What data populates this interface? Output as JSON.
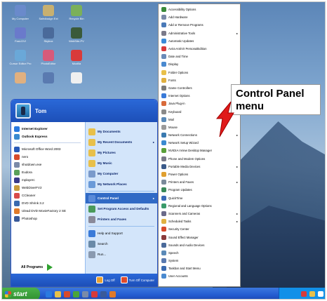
{
  "desktop": {
    "icons": [
      {
        "label": "My Computer",
        "color": "#6a8acb"
      },
      {
        "label": "SafeAssign Ext",
        "color": "#c8b070"
      },
      {
        "label": "Recycle Bin",
        "color": "#7bb05a"
      },
      {
        "label": "Fast-DVI",
        "color": "#6a7acb"
      },
      {
        "label": "Skybox",
        "color": "#4a6a9a"
      },
      {
        "label": "WebSite-PV",
        "color": "#3a5a3a"
      },
      {
        "label": "Cursor Editor Pro",
        "color": "#6aa8d8"
      },
      {
        "label": "PhotoEditor",
        "color": "#d85a7a"
      },
      {
        "label": "Mozilla",
        "color": "#d83a3a"
      },
      {
        "label": "",
        "color": "#e0b080"
      },
      {
        "label": "",
        "color": "#5a7ab0"
      },
      {
        "label": "",
        "color": "#f0f0f0"
      }
    ]
  },
  "start_menu": {
    "user_name": "Tom",
    "pinned": [
      {
        "label": "Internet Explorer",
        "color": "#2a7ae0"
      },
      {
        "label": "Outlook Express",
        "color": "#3a8ad0"
      }
    ],
    "recent": [
      {
        "label": "Microsoft Office Word 2003",
        "color": "#2a5ab8"
      },
      {
        "label": "nero",
        "color": "#d84a2a"
      },
      {
        "label": "shutdown.exe",
        "color": "#7a8aa8"
      },
      {
        "label": "Eudora",
        "color": "#5aa05a"
      },
      {
        "label": "mplayerc",
        "color": "#3a3a8a"
      },
      {
        "label": "WebDiverFV2",
        "color": "#c89a3a"
      },
      {
        "label": "CCleaner",
        "color": "#d84a4a"
      },
      {
        "label": "DVD Shrink 3.2",
        "color": "#3a6ab0"
      },
      {
        "label": "Ulead DVD MovieFactory 2 SE",
        "color": "#e07a2a"
      },
      {
        "label": "Photoshop",
        "color": "#3a5a9a"
      }
    ],
    "all_programs_label": "All Programs",
    "right_items": [
      {
        "label": "My Documents",
        "color": "#e8c04a",
        "arrow": ""
      },
      {
        "label": "My Recent Documents",
        "color": "#e8c04a",
        "arrow": "▸"
      },
      {
        "label": "My Pictures",
        "color": "#e8c04a",
        "arrow": ""
      },
      {
        "label": "My Music",
        "color": "#e8c04a",
        "arrow": ""
      },
      {
        "label": "My Computer",
        "color": "#7a9acb",
        "arrow": ""
      },
      {
        "label": "My Network Places",
        "color": "#6a9ad8",
        "arrow": ""
      }
    ],
    "right_items_2": [
      {
        "label": "Control Panel",
        "color": "#5a8ad8",
        "arrow": "▸"
      },
      {
        "label": "Set Program Access and Defaults",
        "color": "#4a9a5a",
        "arrow": ""
      },
      {
        "label": "Printers and Faxes",
        "color": "#8a8a9a",
        "arrow": ""
      }
    ],
    "right_items_3": [
      {
        "label": "Help and Support",
        "color": "#3a7ad8",
        "arrow": ""
      },
      {
        "label": "Search",
        "color": "#6a8aa8",
        "arrow": ""
      },
      {
        "label": "Run...",
        "color": "#8a9ab0",
        "arrow": ""
      }
    ],
    "logoff_label": "Log Off",
    "turnoff_label": "Turn Off Computer"
  },
  "control_panel_menu": {
    "items": [
      {
        "label": "Accessibility Options",
        "color": "#3a8a3a",
        "arrow": ""
      },
      {
        "label": "Add Hardware",
        "color": "#7a8aa8",
        "arrow": ""
      },
      {
        "label": "Add or Remove Programs",
        "color": "#4a7ab8",
        "arrow": ""
      },
      {
        "label": "Administrative Tools",
        "color": "#7a7a8a",
        "arrow": "▸"
      },
      {
        "label": "Automatic Updates",
        "color": "#3a8ad8",
        "arrow": ""
      },
      {
        "label": "Avira AntiVir PersonalEdition",
        "color": "#d83a3a",
        "arrow": ""
      },
      {
        "label": "Date and Time",
        "color": "#6a8ab8",
        "arrow": ""
      },
      {
        "label": "Display",
        "color": "#4a8ad0",
        "arrow": ""
      },
      {
        "label": "Folder Options",
        "color": "#e8c04a",
        "arrow": ""
      },
      {
        "label": "Fonts",
        "color": "#e0b040",
        "arrow": ""
      },
      {
        "label": "Game Controllers",
        "color": "#7a7a7a",
        "arrow": ""
      },
      {
        "label": "Internet Options",
        "color": "#3a7ad8",
        "arrow": ""
      },
      {
        "label": "Java Plug-in",
        "color": "#d86a3a",
        "arrow": ""
      },
      {
        "label": "Keyboard",
        "color": "#8a8a8a",
        "arrow": ""
      },
      {
        "label": "Mail",
        "color": "#5a8ab8",
        "arrow": ""
      },
      {
        "label": "Mouse",
        "color": "#9a9a9a",
        "arrow": ""
      },
      {
        "label": "Network Connections",
        "color": "#3a7ab0",
        "arrow": "▸"
      },
      {
        "label": "Network Setup Wizard",
        "color": "#3a8ad0",
        "arrow": ""
      },
      {
        "label": "NVIDIA nView Desktop Manager",
        "color": "#5aa03a",
        "arrow": ""
      },
      {
        "label": "Phone and Modem Options",
        "color": "#7a7a8a",
        "arrow": ""
      },
      {
        "label": "Portable Media Devices",
        "color": "#3a5a8a",
        "arrow": "▸"
      },
      {
        "label": "Power Options",
        "color": "#e0a030",
        "arrow": ""
      },
      {
        "label": "Printers and Faxes",
        "color": "#7a8a9a",
        "arrow": "▸"
      },
      {
        "label": "Program Updates",
        "color": "#3a8a5a",
        "arrow": ""
      },
      {
        "label": "QuickTime",
        "color": "#3a6ab8",
        "arrow": ""
      },
      {
        "label": "Regional and Language Options",
        "color": "#3a9a6a",
        "arrow": ""
      },
      {
        "label": "Scanners and Cameras",
        "color": "#6a6a8a",
        "arrow": "▸"
      },
      {
        "label": "Scheduled Tasks",
        "color": "#e0b040",
        "arrow": "▸"
      },
      {
        "label": "Security Center",
        "color": "#d84a2a",
        "arrow": ""
      },
      {
        "label": "Sound Effect Manager",
        "color": "#8a3a3a",
        "arrow": ""
      },
      {
        "label": "Sounds and Audio Devices",
        "color": "#4a6a9a",
        "arrow": ""
      },
      {
        "label": "Speech",
        "color": "#5a8ab8",
        "arrow": ""
      },
      {
        "label": "System",
        "color": "#5a7ab0",
        "arrow": ""
      },
      {
        "label": "Taskbar and Start Menu",
        "color": "#3a6ab0",
        "arrow": ""
      },
      {
        "label": "User Accounts",
        "color": "#4a8ad0",
        "arrow": ""
      }
    ]
  },
  "callout": {
    "text_line1": "Control Panel",
    "text_line2": "menu"
  },
  "taskbar": {
    "start_label": "start",
    "quick_icon_colors": [
      "#2a7ae0",
      "#e8c04a",
      "#d84a2a",
      "#4aa53a",
      "#7a8aa8",
      "#d83a3a",
      "#3a5a9a",
      "#e07a2a"
    ],
    "tray_icon_colors": [
      "#d83a3a",
      "#e8c04a",
      "#ffffff"
    ]
  }
}
